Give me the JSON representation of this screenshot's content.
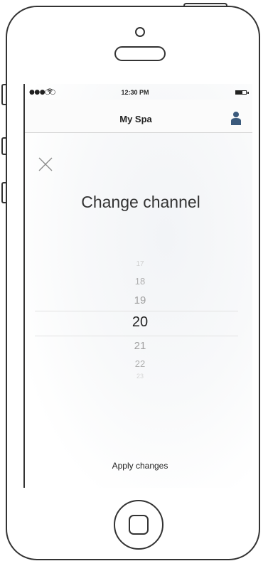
{
  "status_bar": {
    "signal": "●●●○○",
    "time": "12:30 PM",
    "battery_level": 0.65
  },
  "nav": {
    "title": "My Spa"
  },
  "modal": {
    "title": "Change channel",
    "picker": {
      "items": [
        "17",
        "18",
        "19",
        "20",
        "21",
        "22",
        "23"
      ],
      "selected": "20"
    },
    "apply_label": "Apply changes"
  },
  "colors": {
    "user_icon": "#3b5a7c",
    "outline": "#333333"
  },
  "icons": {
    "wifi": "wifi-icon",
    "battery": "battery-icon",
    "user": "user-icon",
    "close": "close-icon",
    "home": "home-button"
  }
}
